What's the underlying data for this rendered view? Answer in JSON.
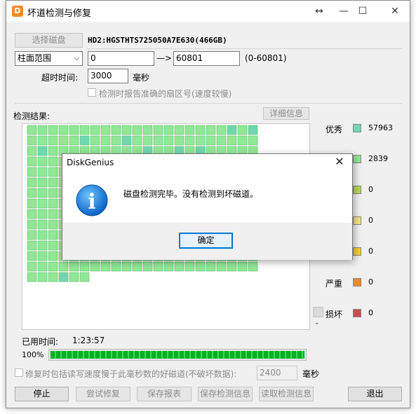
{
  "window": {
    "title": "坏道检测与修复",
    "move_glyph": "↔",
    "minimize_glyph": "—",
    "maximize_glyph": "☐",
    "close_glyph": "✕"
  },
  "disk": {
    "select_button": "选择磁盘",
    "disk_name": "HD2:HGSTHTS725050A7E630(466GB)"
  },
  "range": {
    "mode_selected": "柱面范围",
    "start": "0",
    "arrow": "—>",
    "end": "60801",
    "hint": "(0-60801)"
  },
  "timeout": {
    "label": "超时时间:",
    "value": "3000",
    "unit": "毫秒"
  },
  "report_sector": {
    "label": "检测时报告准确的扇区号(速度较慢)",
    "checked": false
  },
  "results": {
    "label": "检测结果:",
    "details_button": "详细信息",
    "grid": {
      "columns": 22,
      "rows": 15,
      "total_cells": 314,
      "highlight_cells": [
        19,
        21,
        27,
        31,
        45,
        55,
        58,
        60,
        71,
        78,
        125,
        283,
        311
      ],
      "color_good": "#90e896",
      "color_highlight": "#6fd8b0"
    }
  },
  "legend": [
    {
      "label": "优秀",
      "count": "57963",
      "color": "#6fd8b0"
    },
    {
      "label": "",
      "count": "2839",
      "color": "#90e896"
    },
    {
      "label": "",
      "count": "0",
      "color": "#b6d85a"
    },
    {
      "label": "",
      "count": "0",
      "color": "#f3e38a"
    },
    {
      "label": "",
      "count": "0",
      "color": "#f7cc32"
    },
    {
      "label": "严重",
      "count": "0",
      "color": "#e98a2b"
    },
    {
      "label": "损坏",
      "count": "0",
      "color": "#cc4c4c"
    }
  ],
  "elapsed": {
    "label": "已用时间:",
    "value": "1:23:57"
  },
  "progress": {
    "percent_label": "100%",
    "fraction": 1.0
  },
  "repair_option": {
    "label": "修复时包括读写速度慢于此毫秒数的好磁道(不破坏数据):",
    "value": "2400",
    "unit": "毫秒",
    "checked": false
  },
  "buttons": {
    "stop": "停止",
    "try_repair": "尝试修复",
    "save_report": "保存报表",
    "save_info": "保存检测信息",
    "load_info": "读取检测信息",
    "exit": "退出"
  },
  "dialog": {
    "title": "DiskGenius",
    "message": "磁盘检测完毕。没有检测到坏磁道。",
    "ok": "确定",
    "close_glyph": "✕",
    "icon_glyph": "i"
  }
}
